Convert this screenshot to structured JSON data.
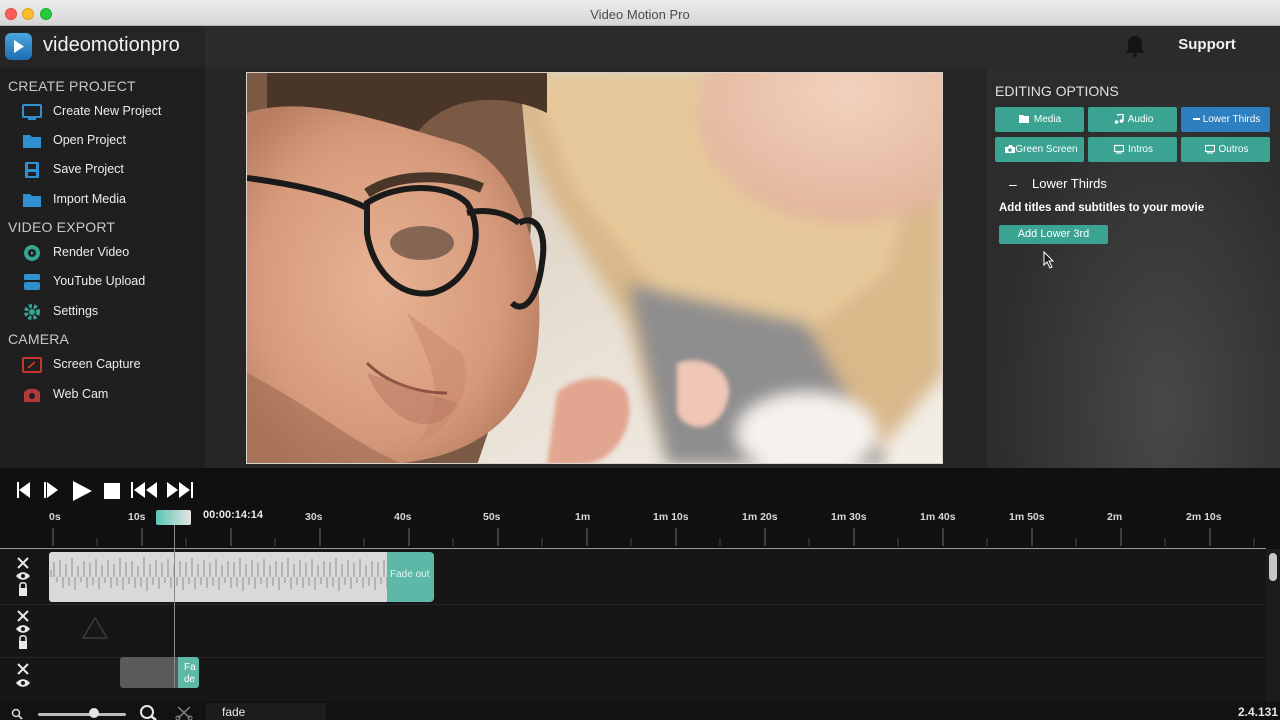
{
  "window": {
    "title": "Video Motion Pro"
  },
  "header": {
    "brand": "videomotionpro",
    "support_label": "Support"
  },
  "sidebar": {
    "sections": [
      {
        "title": "CREATE PROJECT"
      },
      {
        "title": "VIDEO EXPORT"
      },
      {
        "title": "CAMERA"
      }
    ],
    "items": [
      {
        "label": "Create New Project",
        "icon": "monitor-icon"
      },
      {
        "label": "Open Project",
        "icon": "folder-icon"
      },
      {
        "label": "Save Project",
        "icon": "save-icon"
      },
      {
        "label": "Import Media",
        "icon": "folder-import-icon"
      },
      {
        "label": "Render Video",
        "icon": "render-icon"
      },
      {
        "label": "YouTube Upload",
        "icon": "youtube-icon"
      },
      {
        "label": "Settings",
        "icon": "gear-icon"
      },
      {
        "label": "Screen Capture",
        "icon": "screen-capture-icon"
      },
      {
        "label": "Web Cam",
        "icon": "webcam-icon"
      }
    ]
  },
  "editing": {
    "title": "EDITING OPTIONS",
    "buttons": [
      {
        "label": "Media",
        "icon": "folder-icon"
      },
      {
        "label": "Audio",
        "icon": "music-note-icon"
      },
      {
        "label": "Lower Thirds",
        "icon": "lower-thirds-icon",
        "active": true
      },
      {
        "label": "Green Screen",
        "icon": "camera-icon"
      },
      {
        "label": "Intros",
        "icon": "screen-icon"
      },
      {
        "label": "Outros",
        "icon": "screen-icon"
      }
    ],
    "section_toggle": "–",
    "section_title": "Lower Thirds",
    "description": "Add titles and subtitles to your movie",
    "add_button": "Add Lower 3rd"
  },
  "timeline": {
    "ruler_labels": [
      "0s",
      "10s",
      "30s",
      "40s",
      "50s",
      "1m",
      "1m 10s",
      "1m 20s",
      "1m 30s",
      "1m 40s",
      "1m 50s",
      "2m",
      "2m 10s"
    ],
    "timecode": "00:00:14:14",
    "clips": [
      {
        "fade_label": "Fade out"
      },
      {
        "fade_label": "Fa de"
      }
    ]
  },
  "bottom": {
    "search_value": "fade",
    "version": "2.4.131"
  },
  "colors": {
    "accent": "#3aa392",
    "active": "#2e7fbf",
    "background": "#1e1e1e"
  }
}
